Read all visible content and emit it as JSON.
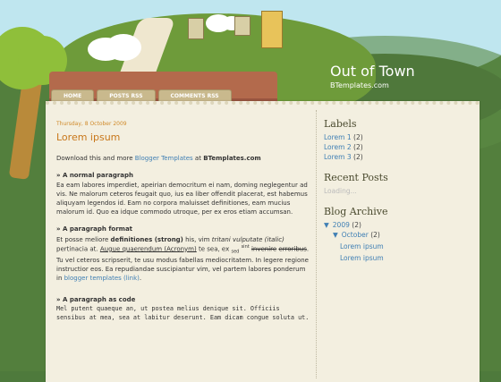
{
  "blog": {
    "title": "Out of Town",
    "subtitle": "BTemplates.com"
  },
  "nav": {
    "tabs": [
      "HOME",
      "POSTS RSS",
      "COMMENTS RSS"
    ]
  },
  "post": {
    "date": "Thursday, 8 October 2009",
    "title": "Lorem ipsum",
    "intro_prefix": "Download this and more ",
    "intro_link": "Blogger Templates",
    "intro_mid": " at ",
    "intro_strong": "BTemplates.com",
    "normal_head": "» A normal paragraph",
    "normal_text": "Ea eam labores imperdiet, apeirian democritum ei nam, doming neglegentur ad vis. Ne malorum ceteros feugait quo, ius ea liber offendit placerat, est habemus aliquyam legendos id. Eam no corpora maluisset definitiones, eam mucius malorum id. Quo ea idque commodo utroque, per ex eros etiam accumsan.",
    "format_head": "» A paragraph format",
    "f1": "Et posse meliore ",
    "f2": "definitiones (strong)",
    "f3": " his, vim ",
    "f4": "tritani vulputate (italic)",
    "f5": " pertinacia at. ",
    "f6": "Augue quaerendum (Acronym)",
    "f7": " te sea, ex ",
    "f8": "sed",
    "f9": "sint",
    "f10": "invenire",
    "f11": "erroribus",
    "f12": ". Tu vel ceteros scripserit, te usu modus fabellas mediocritatem. In legere regione instructior eos. Ea repudiandae suscipiantur vim, vel partem labores ponderum in ",
    "f13": "blogger templates (link)",
    "f14": ".",
    "code_head": "» A paragraph as code",
    "code_text": "Mel putent quaeque an, ut postea melius denique sit. Officiis sensibus at mea, sea at labitur deserunt. Eam dicam congue soluta ut."
  },
  "sidebar": {
    "labels_title": "Labels",
    "labels": [
      {
        "name": "Lorem 1",
        "count": "(2)"
      },
      {
        "name": "Lorem 2",
        "count": "(2)"
      },
      {
        "name": "Lorem 3",
        "count": "(2)"
      }
    ],
    "recent_title": "Recent Posts",
    "recent_loading": "Loading...",
    "archive_title": "Blog Archive",
    "year": "2009",
    "year_count": "(2)",
    "month": "October",
    "month_count": "(2)",
    "archive_posts": [
      "Lorem ipsum",
      "Lorem ipsum"
    ]
  }
}
